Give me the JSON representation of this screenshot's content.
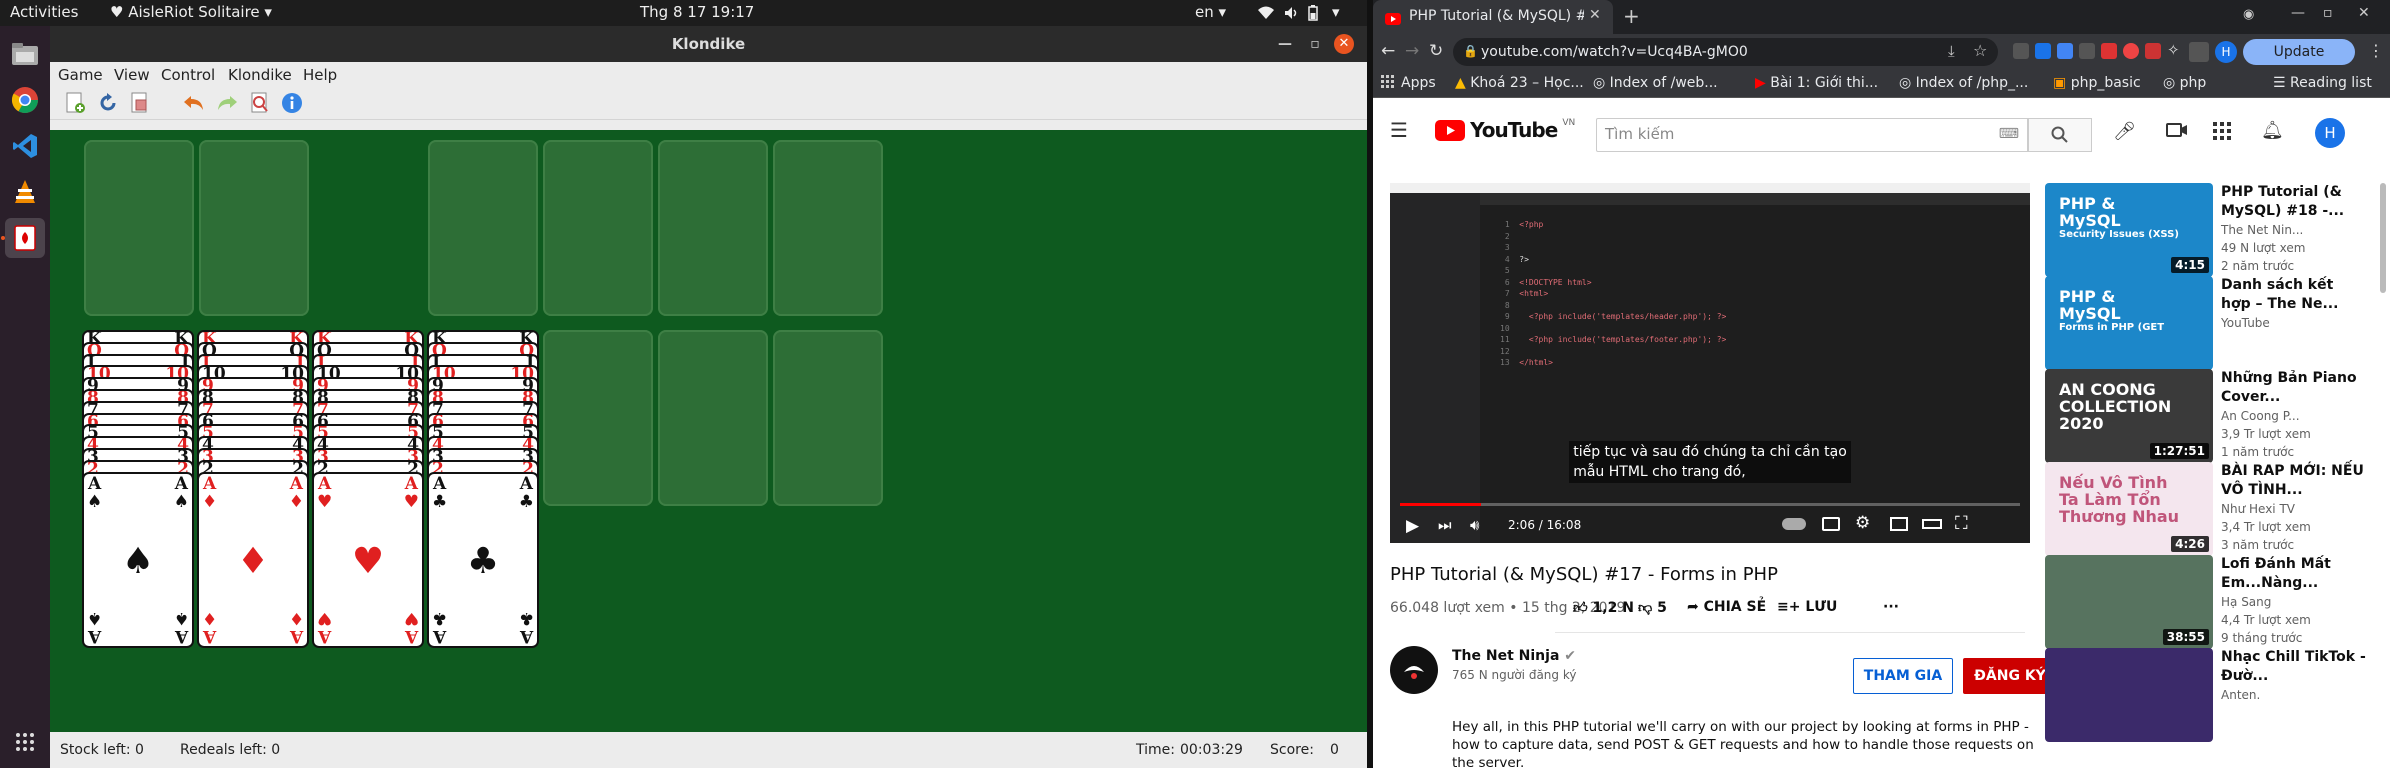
{
  "topbar": {
    "activities": "Activities",
    "app_menu": "AisleRiot Solitaire",
    "clock": "Thg 8 17  19:17",
    "lang": "en"
  },
  "solitaire": {
    "title": "Klondike",
    "menu": [
      "Game",
      "View",
      "Control",
      "Klondike",
      "Help"
    ],
    "status": {
      "stock": "Stock left: 0",
      "redeals": "Redeals left: 0",
      "time_label": "Time:",
      "time": "00:03:29",
      "score_label": "Score:",
      "score": "0"
    },
    "tableau_ranks": [
      "K",
      "Q",
      "J",
      "10",
      "9",
      "8",
      "7",
      "6",
      "5",
      "4",
      "3",
      "2"
    ],
    "aces": [
      {
        "rank": "A",
        "suit": "♠",
        "color": "blk"
      },
      {
        "rank": "A",
        "suit": "♦",
        "color": "red"
      },
      {
        "rank": "A",
        "suit": "♥",
        "color": "red"
      },
      {
        "rank": "A",
        "suit": "♣",
        "color": "blk"
      }
    ]
  },
  "chrome": {
    "tab_title": "PHP Tutorial (& MySQL) #",
    "url": "youtube.com/watch?v=Ucq4BA-gMO0",
    "update": "Update",
    "profile": "H",
    "bookmarks": [
      "Apps",
      "Khoá 23 – Học...",
      "Index of /web...",
      "Bài 1: Giới thi...",
      "Index of /php_...",
      "php_basic",
      "php"
    ],
    "reading_list": "Reading list"
  },
  "youtube": {
    "logo": "YouTube",
    "country": "VN",
    "search_placeholder": "Tìm kiếm",
    "video": {
      "title": "PHP Tutorial (& MySQL) #17 - Forms in PHP",
      "meta": "66.048 lượt xem • 15 thg 2, 2019",
      "likes": "1,2 N",
      "dislikes": "5",
      "share": "CHIA SẺ",
      "save": "LƯU",
      "time": "2:06 / 16:08",
      "caption_1": "tiếp tục và sau đó chúng ta chỉ cần tạo",
      "caption_2": "mẫu HTML cho trang đó,",
      "code": [
        "<?php",
        "",
        "",
        "?>",
        "",
        "<!DOCTYPE html>",
        "<html>",
        "",
        "  <?php include('templates/header.php'); ?>",
        "",
        "  <?php include('templates/footer.php'); ?>",
        "",
        "</html>"
      ]
    },
    "channel": {
      "name": "The Net Ninja",
      "subs": "765 N người đăng ký",
      "join": "THAM GIA",
      "subscribe": "ĐĂNG KÝ"
    },
    "description": "Hey all, in this PHP tutorial we'll carry on with our project by looking at forms in PHP - how to capture data, send POST & GET requests and how to handle those requests on the server.",
    "recommendations": [
      {
        "title": "PHP Tutorial (& MySQL) #18 -...",
        "channel": "The Net Nin...",
        "views": "49 N lượt xem",
        "date": "2 năm trước",
        "duration": "4:15",
        "thumb_text_1": "PHP &",
        "thumb_text_2": "MySQL",
        "thumb_text_3": "Security Issues (XSS)"
      },
      {
        "title": "Danh sách kết hợp – The Ne...",
        "channel": "YouTube",
        "views": "",
        "date": "",
        "duration": "",
        "thumb_text_1": "PHP &",
        "thumb_text_2": "MySQL",
        "thumb_text_3": "Forms in PHP (GET"
      },
      {
        "title": "Những Bản Piano Cover...",
        "channel": "An Coong P...",
        "views": "3,9 Tr lượt xem",
        "date": "1 năm trước",
        "duration": "1:27:51",
        "thumb_text_1": "AN COONG",
        "thumb_text_2": "COLLECTION 2020",
        "thumb_text_3": ""
      },
      {
        "title": "BÀI RAP MỚI: NẾU VÔ TÌNH...",
        "channel": "Như Hexi TV",
        "views": "3,4 Tr lượt xem",
        "date": "3 năm trước",
        "duration": "4:26",
        "thumb_text_1": "Nếu Vô Tình",
        "thumb_text_2": "Ta Làm Tổn Thương Nhau",
        "thumb_text_3": ""
      },
      {
        "title": "Lofi Đánh Mất Em...Nàng...",
        "channel": "Hạ Sang",
        "views": "4,4 Tr lượt xem",
        "date": "9 tháng trước",
        "duration": "38:55",
        "thumb_text_1": "",
        "thumb_text_2": "",
        "thumb_text_3": ""
      },
      {
        "title": "Nhạc Chill TikTok - Đườ...",
        "channel": "Anten.",
        "views": "",
        "date": "",
        "duration": "",
        "thumb_text_1": "",
        "thumb_text_2": "",
        "thumb_text_3": ""
      }
    ]
  }
}
